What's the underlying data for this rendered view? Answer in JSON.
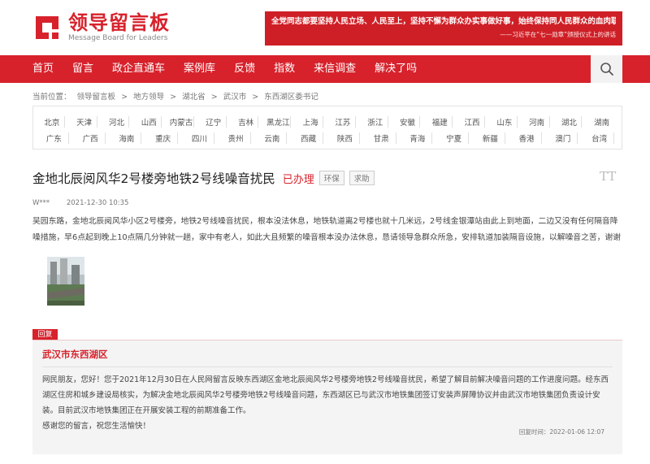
{
  "header": {
    "logo_cn": "领导留言板",
    "logo_en": "Message Board for Leaders",
    "banner_main": "全党同志都要坚持人民立场、人民至上，坚持不懈为群众办实事做好事，始终保持同人民群众的血肉联系。",
    "banner_sub": "——习近平在“七一勋章”颁授仪式上的讲话"
  },
  "nav": {
    "items": [
      "首页",
      "留言",
      "政企直通车",
      "案例库",
      "反馈",
      "指数",
      "来信调查",
      "解决了吗"
    ]
  },
  "breadcrumb": {
    "items": [
      "当前位置：",
      "领导留言板",
      ">",
      "地方领导",
      ">",
      "湖北省",
      ">",
      "武汉市",
      ">",
      "东西湖区委书记"
    ]
  },
  "regions": {
    "row1": [
      "北京",
      "天津",
      "河北",
      "山西",
      "内蒙古",
      "辽宁",
      "吉林",
      "黑龙江",
      "上海",
      "江苏",
      "浙江",
      "安徽",
      "福建",
      "江西",
      "山东",
      "河南",
      "湖北",
      "湖南"
    ],
    "row2": [
      "广东",
      "广西",
      "海南",
      "重庆",
      "四川",
      "贵州",
      "云南",
      "西藏",
      "陕西",
      "甘肃",
      "青海",
      "宁夏",
      "新疆",
      "香港",
      "澳门",
      "台湾"
    ]
  },
  "message": {
    "title": "金地北辰阅风华2号楼旁地铁2号线噪音扰民",
    "status": "已办理",
    "tags": [
      "环保",
      "求助"
    ],
    "font_btn": "TT",
    "author": "W***",
    "time": "2021-12-30 10:35",
    "content": "吴园东路，金地北辰阅风华小区2号楼旁，地铁2号线噪音扰民，根本没法休息，地铁轨道离2号楼也就十几米远，2号线金银潭站由此上到地面，二边又没有任何隔音降噪措施，早6点起到晚上10点隔几分钟就一趟，家中有老人，如此大且频繁的噪音根本没办法休息，恳请领导急群众所急，安排轨道加装隔音设施，以解噪音之苦，谢谢"
  },
  "reply": {
    "label": "回复",
    "org": "武汉市东西湖区",
    "para1": "网民朋友，您好！您于2021年12月30日在人民网留言反映东西湖区金地北辰阅风华2号楼旁地铁2号线噪音扰民，希望了解目前解决噪音问题的工作进度问题。经东西湖区住房和城乡建设局核实，为解决金地北辰阅风华2号楼旁地铁2号线噪音问题，东西湖区已与武汉市地铁集团签订安装声屏障协议并由武汉市地铁集团负责设计安装。目前武汉市地铁集团正在开展安装工程的前期准备工作。",
    "para2": "感谢您的留言，祝您生活愉快！",
    "time_label": "回复时间：",
    "time": "2022-01-06 12:07"
  },
  "colors": {
    "brand_red": "#d7222c"
  }
}
